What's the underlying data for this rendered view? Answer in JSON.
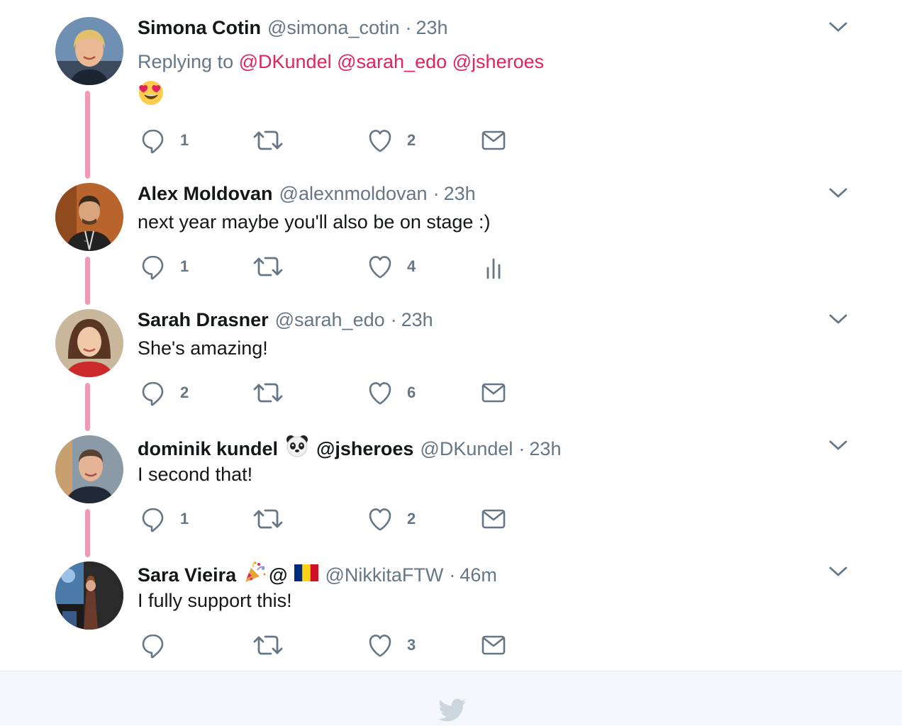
{
  "tweets": [
    {
      "name": "Simona Cotin",
      "handle": "@simona_cotin",
      "time": "23h",
      "replying_label": "Replying to",
      "mentions": [
        "@DKundel",
        "@sarah_edo",
        "@jsheroes"
      ],
      "text_emoji": "heart-eyes-emoji",
      "reply_count": "1",
      "like_count": "2",
      "last_action": "message-icon"
    },
    {
      "name": "Alex Moldovan",
      "handle": "@alexnmoldovan",
      "time": "23h",
      "text": "next year maybe you'll also be on stage :)",
      "reply_count": "1",
      "like_count": "4",
      "last_action": "analytics-icon"
    },
    {
      "name": "Sarah Drasner",
      "handle": "@sarah_edo",
      "time": "23h",
      "text": "She's amazing!",
      "reply_count": "2",
      "like_count": "6",
      "last_action": "message-icon"
    },
    {
      "name": "dominik kundel",
      "name_emoji": "panda-emoji",
      "name_suffix": "@jsheroes",
      "handle": "@DKundel",
      "time": "23h",
      "text": "I second that!",
      "reply_count": "1",
      "like_count": "2",
      "last_action": "message-icon"
    },
    {
      "name": "Sara Vieira",
      "name_emoji": "party-popper-emoji",
      "name_suffix": "@",
      "name_emoji2": "romania-flag-emoji",
      "handle": "@NikkitaFTW",
      "time": "46m",
      "text": "I fully support this!",
      "reply_count": "",
      "like_count": "3",
      "last_action": "message-icon"
    }
  ],
  "separator": "·",
  "colors": {
    "thread_line": "#f19bb2",
    "mention": "#e0245e",
    "secondary_text": "#657786",
    "footer_bg": "#f5f8fa",
    "twitter_bird": "#ccd6dd"
  },
  "footer": {
    "icon": "twitter-bird-icon"
  }
}
